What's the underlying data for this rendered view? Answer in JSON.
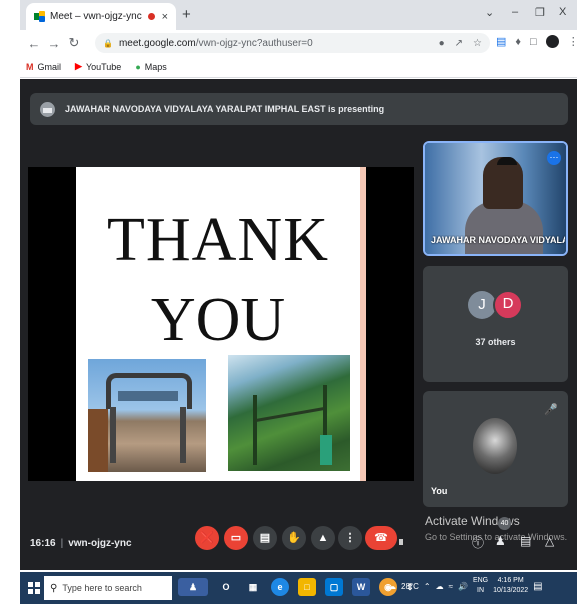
{
  "browser": {
    "tab_title": "Meet – vwn-ojgz-ync",
    "tab_close": "×",
    "new_tab": "+",
    "win_min": "–",
    "win_restore": "❐",
    "win_close": "X",
    "url_host": "meet.google.com",
    "url_path": "/vwn-ojgz-ync?authuser=0",
    "bookmarks": [
      {
        "label": "Gmail",
        "icon": "gmail-icon",
        "color": "#d93025"
      },
      {
        "label": "YouTube",
        "icon": "youtube-icon",
        "color": "#ff0000"
      },
      {
        "label": "Maps",
        "icon": "maps-icon",
        "color": "#34a853"
      }
    ]
  },
  "meet": {
    "presenting_banner": "JAWAHAR NAVODAYA VIDYALAYA YARALPAT IMPHAL EAST is presenting",
    "slide": {
      "line1": "THANK",
      "line2": "YOU"
    },
    "tiles": {
      "presenter_name": "JAWAHAR NAVODAYA VIDYALAY...",
      "others_initials": [
        "J",
        "D"
      ],
      "others_label": "37 others",
      "you_label": "You"
    },
    "watermark": {
      "title": "Activate Windows",
      "subtitle": "Go to Settings to activate Windows."
    },
    "controls": {
      "time": "16:16",
      "separator": "|",
      "meeting_code": "vwn-ojgz-ync",
      "people_badge": "40"
    },
    "colors": {
      "background": "#202124",
      "tile": "#3c4043",
      "danger": "#ea4335",
      "accent": "#8ab4f8"
    }
  },
  "taskbar": {
    "search_placeholder": "Type here to search",
    "weather": "28°C",
    "lang_line1": "ENG",
    "lang_line2": "IN",
    "time": "4:16 PM",
    "date": "10/13/2022"
  }
}
